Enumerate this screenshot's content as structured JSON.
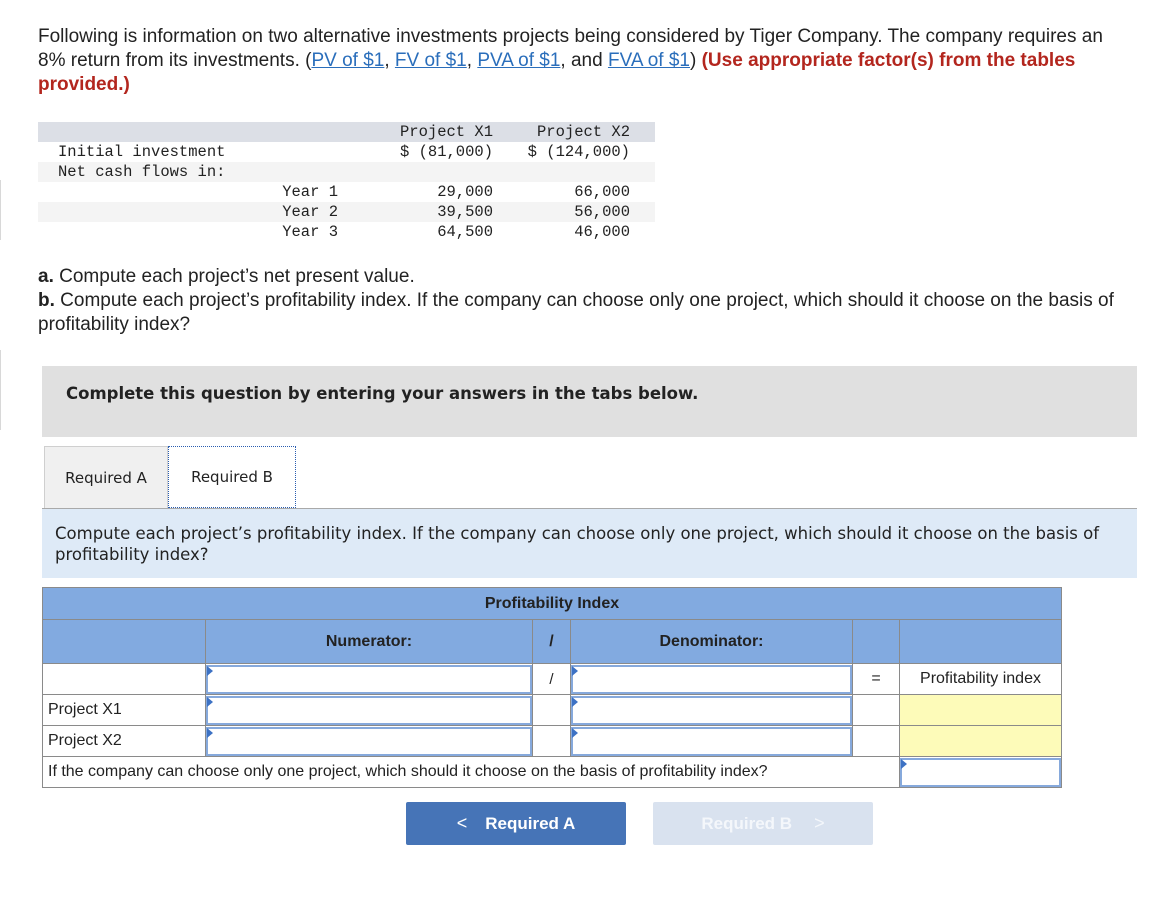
{
  "intro": {
    "text_1": "Following is information on two alternative investments projects being considered by Tiger Company. The company requires an 8% return from its investments. (",
    "links": [
      "PV of $1",
      "FV of $1",
      "PVA of $1",
      "FVA of $1"
    ],
    "sep_1": ", ",
    "sep_2": ", ",
    "sep_3": ", and ",
    "text_2": ") ",
    "emphasis": "(Use appropriate factor(s) from the tables provided.)"
  },
  "given_table": {
    "headers": [
      "",
      "",
      "Project X1",
      "Project X2"
    ],
    "rows": [
      {
        "label": "Initial investment",
        "sub": "",
        "x1": "$ (81,000)",
        "x2": "$ (124,000)"
      },
      {
        "label": "Net cash flows in:",
        "sub": "",
        "x1": "",
        "x2": ""
      },
      {
        "label": "",
        "sub": "Year 1",
        "x1": "29,000",
        "x2": "66,000"
      },
      {
        "label": "",
        "sub": "Year 2",
        "x1": "39,500",
        "x2": "56,000"
      },
      {
        "label": "",
        "sub": "Year 3",
        "x1": "64,500",
        "x2": "46,000"
      }
    ]
  },
  "questions": {
    "a_marker": "a.",
    "a_text": " Compute each project’s net present value.",
    "b_marker": "b.",
    "b_text": " Compute each project’s profitability index. If the company can choose only one project, which should it choose on the basis of profitability index?"
  },
  "banner": "Complete this question by entering your answers in the tabs below.",
  "tabs": [
    {
      "label": "Required A",
      "active": false
    },
    {
      "label": "Required B",
      "active": true
    }
  ],
  "prompt": "Compute each project’s profitability index. If the company can choose only one project, which should it choose on the basis of profitability index?",
  "pi_table": {
    "title": "Profitability Index",
    "numerator_header": "Numerator:",
    "divide_symbol": "/",
    "denominator_header": "Denominator:",
    "equals_symbol": "=",
    "result_label": "Profitability index",
    "rows": [
      {
        "label": "Project X1",
        "numerator": "",
        "denominator": "",
        "result": ""
      },
      {
        "label": "Project X2",
        "numerator": "",
        "denominator": "",
        "result": ""
      }
    ],
    "choice_question": "If the company can choose only one project, which should it choose on the basis of profitability index?",
    "choice_value": ""
  },
  "nav": {
    "prev_label": "Required A",
    "prev_chevron": "<",
    "next_label": "Required B",
    "next_chevron": ">"
  }
}
